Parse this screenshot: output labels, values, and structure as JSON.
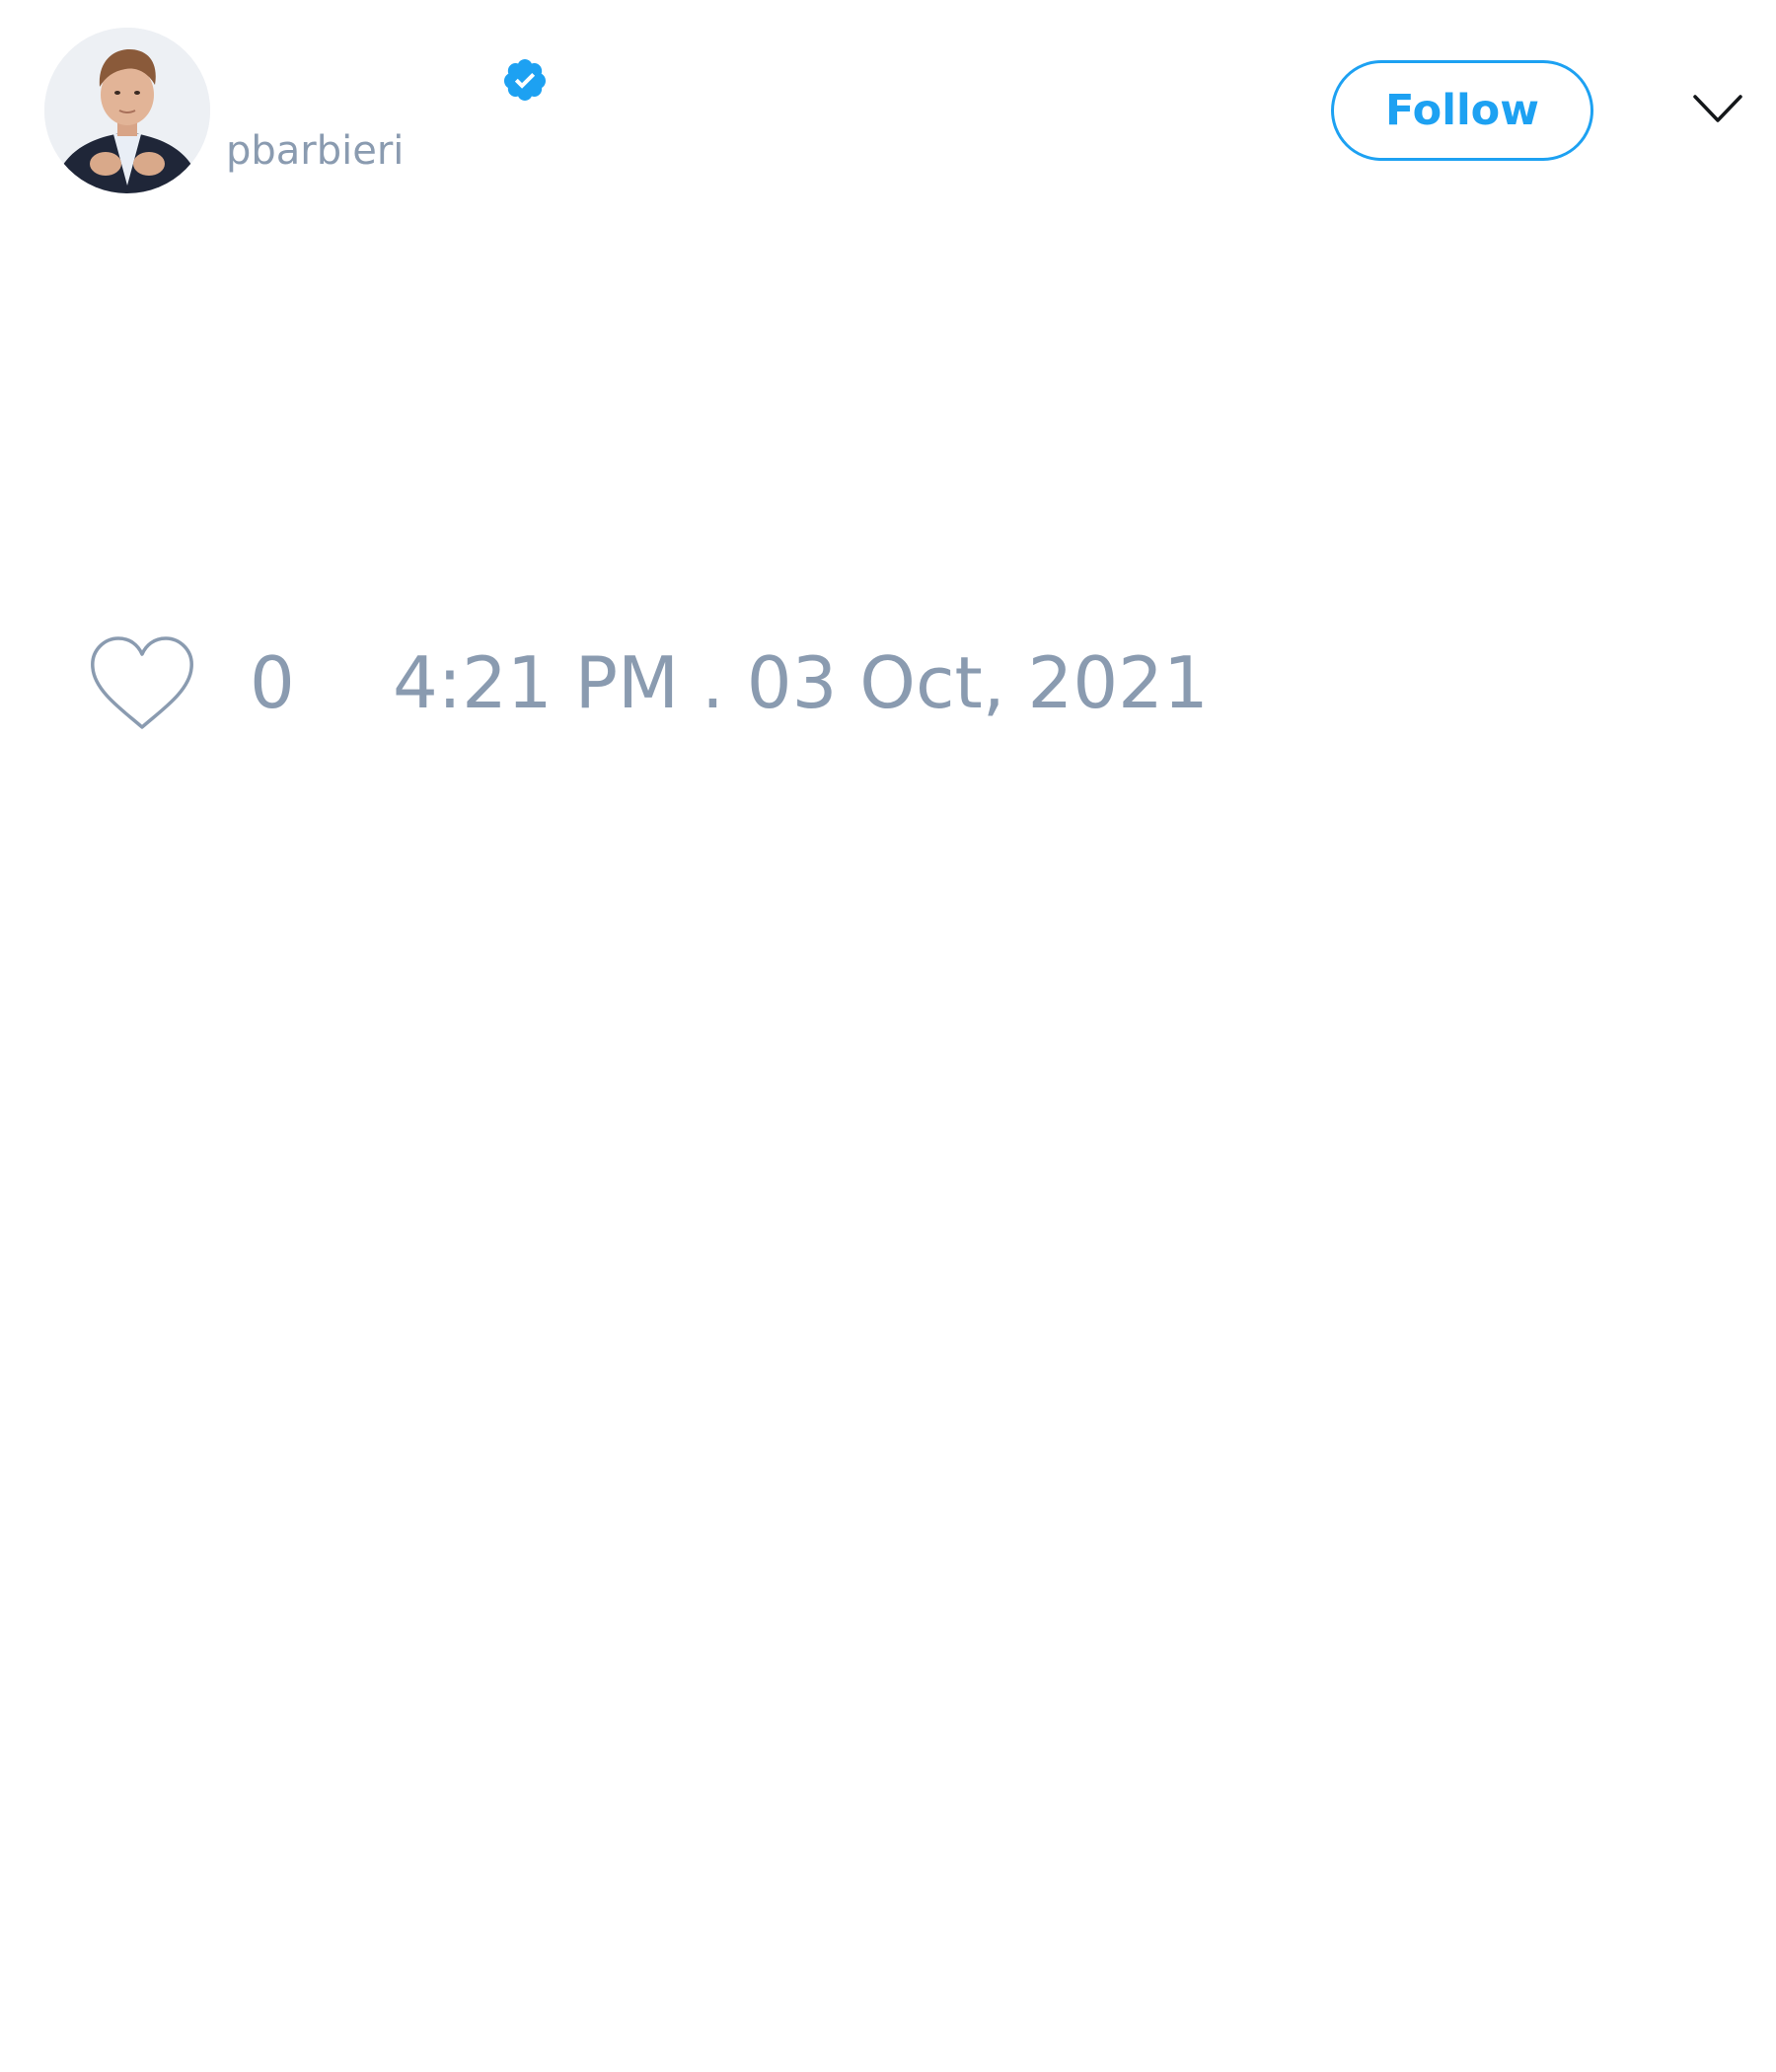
{
  "author": {
    "display_name": "",
    "handle": "pbarbieri",
    "verified": true,
    "avatar_icon": "profile-photo"
  },
  "actions": {
    "follow_label": "Follow",
    "menu_icon": "chevron-down-icon"
  },
  "stats": {
    "like_icon": "heart-icon",
    "like_count": "0",
    "timestamp": "4:21 PM . 03 Oct, 2021"
  },
  "colors": {
    "accent": "#1da1f2",
    "muted_text": "#8a9bb0",
    "background": "#ffffff"
  }
}
